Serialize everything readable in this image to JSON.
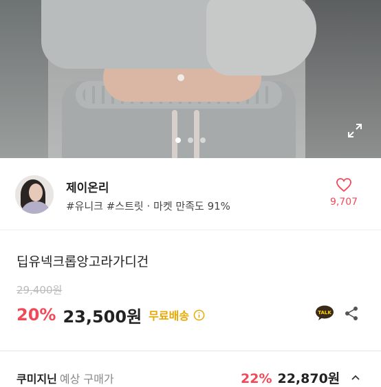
{
  "hero": {
    "image": "product-photo",
    "slide_count": 3,
    "active_slide": 1,
    "expand_icon": "expand-icon"
  },
  "seller": {
    "name": "제이온리",
    "tags": "#유니크 #스트릿",
    "satisfaction": "· 마켓 만족도 91%",
    "like_count": "9,707",
    "like_icon": "heart-icon"
  },
  "product": {
    "title": "딥유넥크롭앙고라가디건",
    "original_price": "29,400원",
    "discount": "20%",
    "price": "23,500원",
    "shipping": "무료배송"
  },
  "actions": {
    "talk_label": "TALK",
    "share_icon": "share-icon"
  },
  "coupon": {
    "label": "쿠미지닌",
    "sub": "예상 구매가",
    "percent": "22%",
    "amount": "22,870원"
  },
  "colors": {
    "accent": "#f04a5a",
    "shipping": "#e8a800",
    "talk": "#3a2a1a"
  }
}
